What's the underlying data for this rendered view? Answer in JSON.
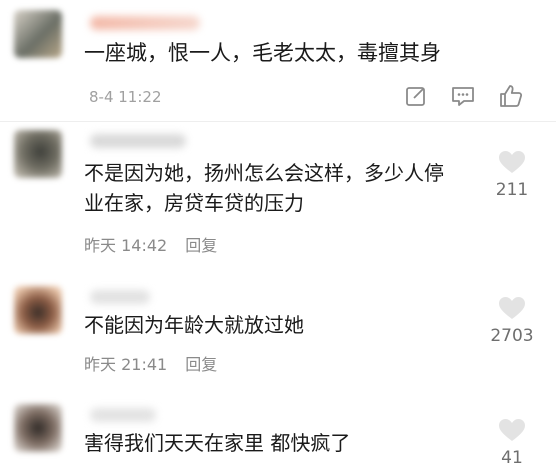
{
  "comments": [
    {
      "text_lines": [
        "一座城，恨一人，毛老太太，毒擅其身"
      ],
      "time": "8-4 11:22"
    },
    {
      "text_lines": [
        "不是因为她，扬州怎么会这样，多少人停",
        "业在家，房贷车贷的压力"
      ],
      "time": "昨天 14:42",
      "reply": "回复",
      "likes": "211"
    },
    {
      "text_lines": [
        "不能因为年龄大就放过她"
      ],
      "time": "昨天 21:41",
      "reply": "回复",
      "likes": "2703"
    },
    {
      "text_lines": [
        "害得我们天天在家里 都快疯了"
      ],
      "likes": "41"
    }
  ],
  "icons": [
    "edit-icon",
    "message-icon",
    "thumbs-up-icon",
    "heart-icon"
  ]
}
